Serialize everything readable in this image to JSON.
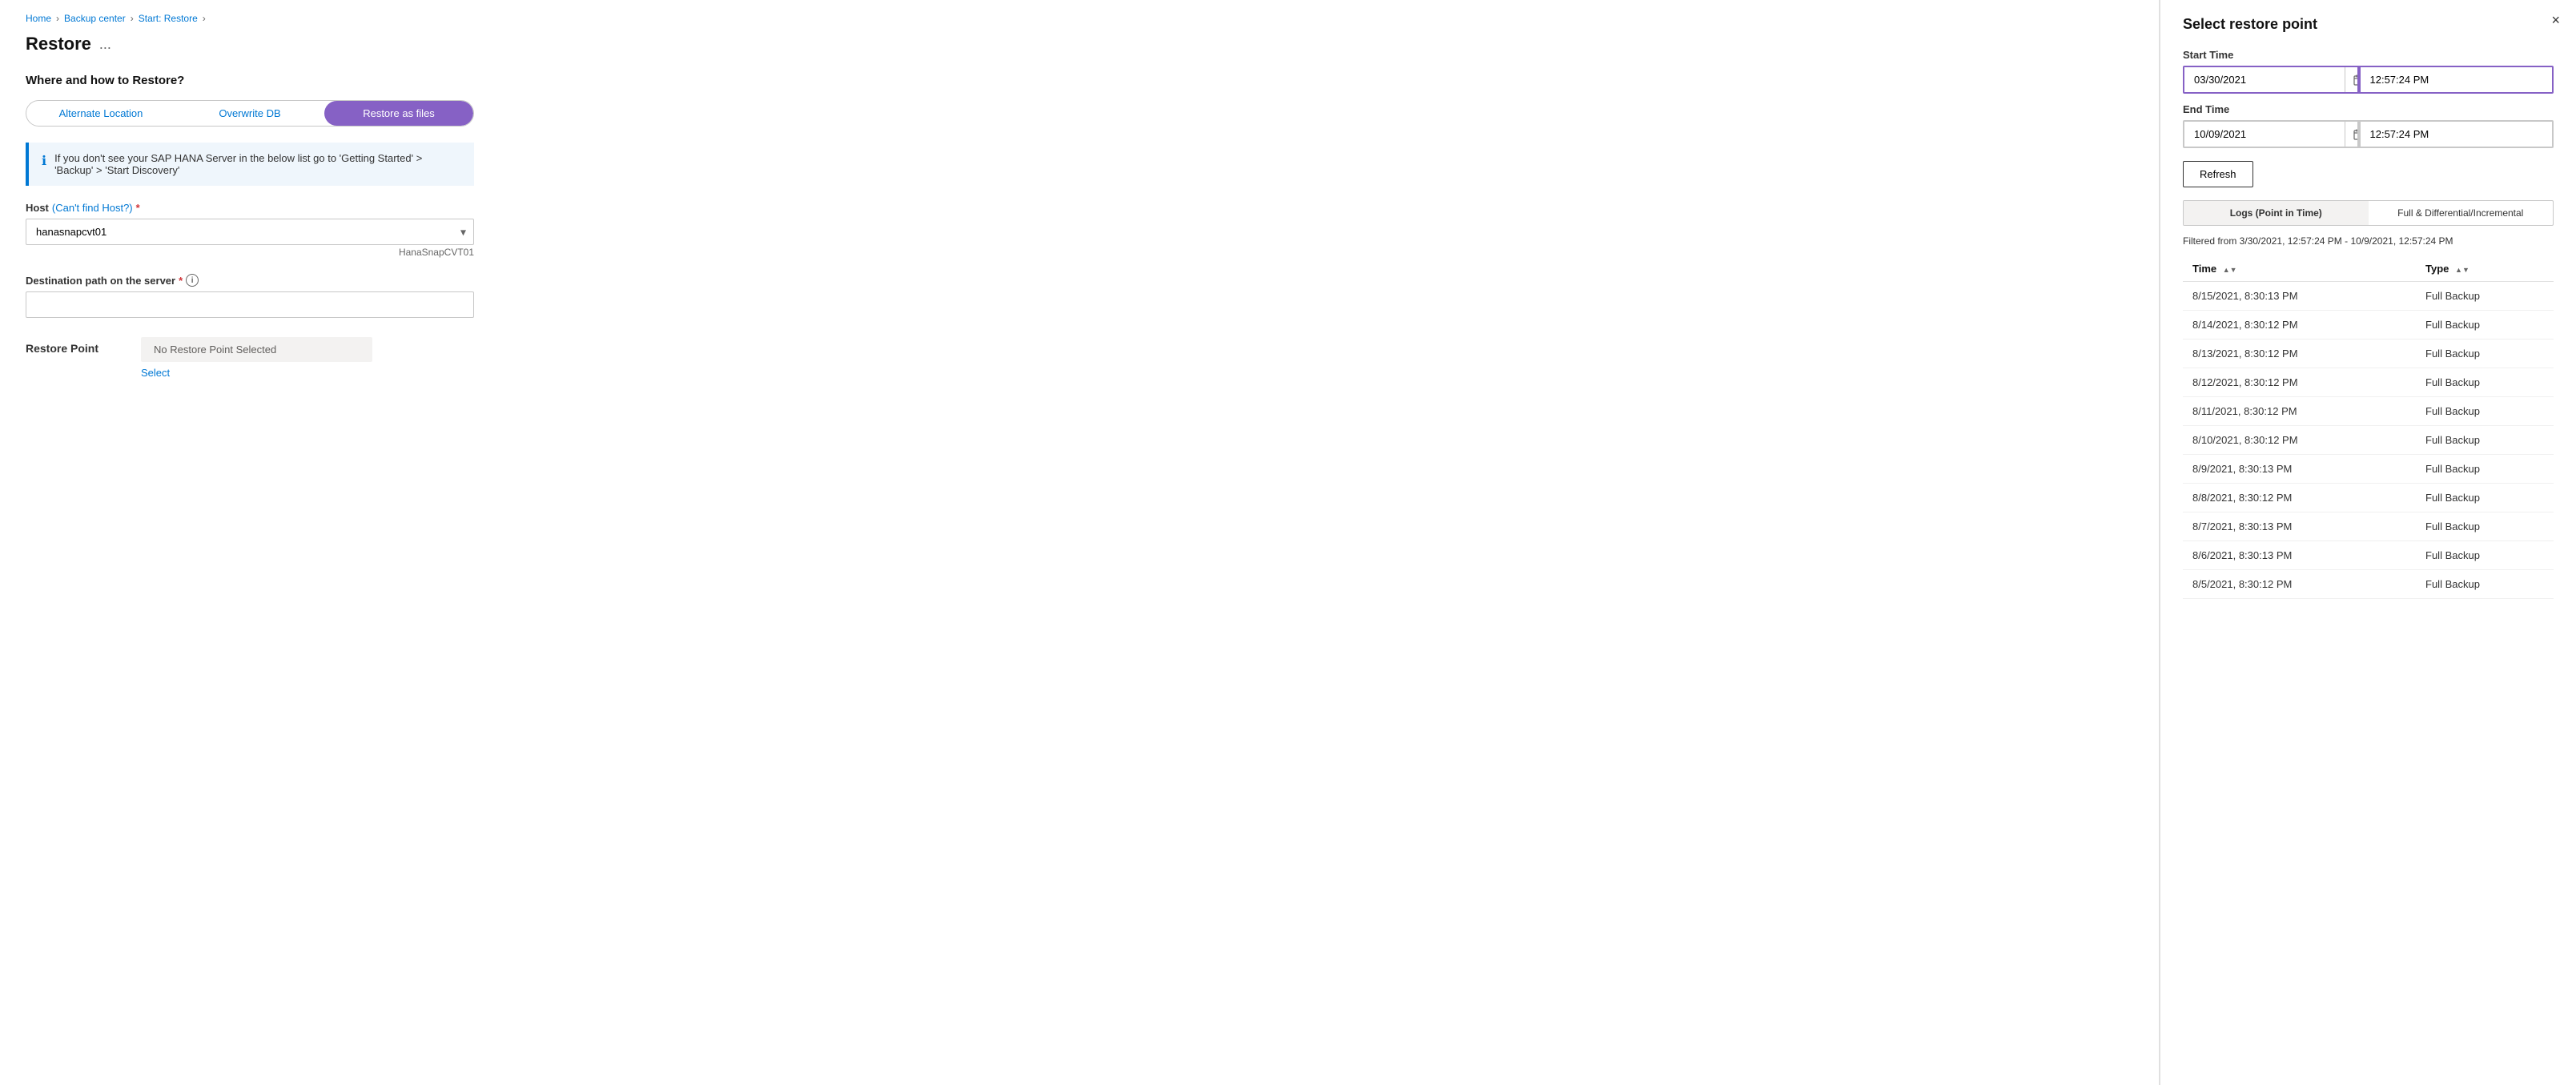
{
  "breadcrumb": {
    "items": [
      "Home",
      "Backup center",
      "Start: Restore"
    ]
  },
  "page": {
    "title": "Restore",
    "ellipsis": "..."
  },
  "section": {
    "where_how": "Where and how to Restore?"
  },
  "tabs": {
    "items": [
      {
        "label": "Alternate Location",
        "active": false
      },
      {
        "label": "Overwrite DB",
        "active": false
      },
      {
        "label": "Restore as files",
        "active": true
      }
    ]
  },
  "info_box": {
    "text": "If you don't see your SAP HANA Server in the below list go to 'Getting Started' > 'Backup' > 'Start Discovery'"
  },
  "host_field": {
    "label": "Host",
    "link_text": "(Can't find Host?)",
    "required": true,
    "value": "hanasnapcvt01",
    "hint": "HanaSnapCVT01",
    "options": [
      "hanasnapcvt01"
    ]
  },
  "destination_field": {
    "label": "Destination path on the server",
    "required": true,
    "value": "",
    "placeholder": ""
  },
  "restore_point": {
    "label": "Restore Point",
    "no_selection_text": "No Restore Point Selected",
    "select_link": "Select"
  },
  "right_panel": {
    "title": "Select restore point",
    "close_label": "×",
    "start_time": {
      "label": "Start Time",
      "date_value": "03/30/2021",
      "time_value": "12:57:24 PM"
    },
    "end_time": {
      "label": "End Time",
      "date_value": "10/09/2021",
      "time_value": "12:57:24 PM"
    },
    "refresh_label": "Refresh",
    "toggle_tabs": [
      {
        "label": "Logs (Point in Time)",
        "active": true
      },
      {
        "label": "Full & Differential/Incremental",
        "active": false
      }
    ],
    "filter_text": "Filtered from 3/30/2021, 12:57:24 PM - 10/9/2021, 12:57:24 PM",
    "table": {
      "columns": [
        {
          "label": "Time",
          "sort": true
        },
        {
          "label": "Type",
          "sort": true
        }
      ],
      "rows": [
        {
          "time": "8/15/2021, 8:30:13 PM",
          "type": "Full Backup"
        },
        {
          "time": "8/14/2021, 8:30:12 PM",
          "type": "Full Backup"
        },
        {
          "time": "8/13/2021, 8:30:12 PM",
          "type": "Full Backup"
        },
        {
          "time": "8/12/2021, 8:30:12 PM",
          "type": "Full Backup"
        },
        {
          "time": "8/11/2021, 8:30:12 PM",
          "type": "Full Backup"
        },
        {
          "time": "8/10/2021, 8:30:12 PM",
          "type": "Full Backup"
        },
        {
          "time": "8/9/2021, 8:30:13 PM",
          "type": "Full Backup"
        },
        {
          "time": "8/8/2021, 8:30:12 PM",
          "type": "Full Backup"
        },
        {
          "time": "8/7/2021, 8:30:13 PM",
          "type": "Full Backup"
        },
        {
          "time": "8/6/2021, 8:30:13 PM",
          "type": "Full Backup"
        },
        {
          "time": "8/5/2021, 8:30:12 PM",
          "type": "Full Backup"
        }
      ]
    }
  }
}
